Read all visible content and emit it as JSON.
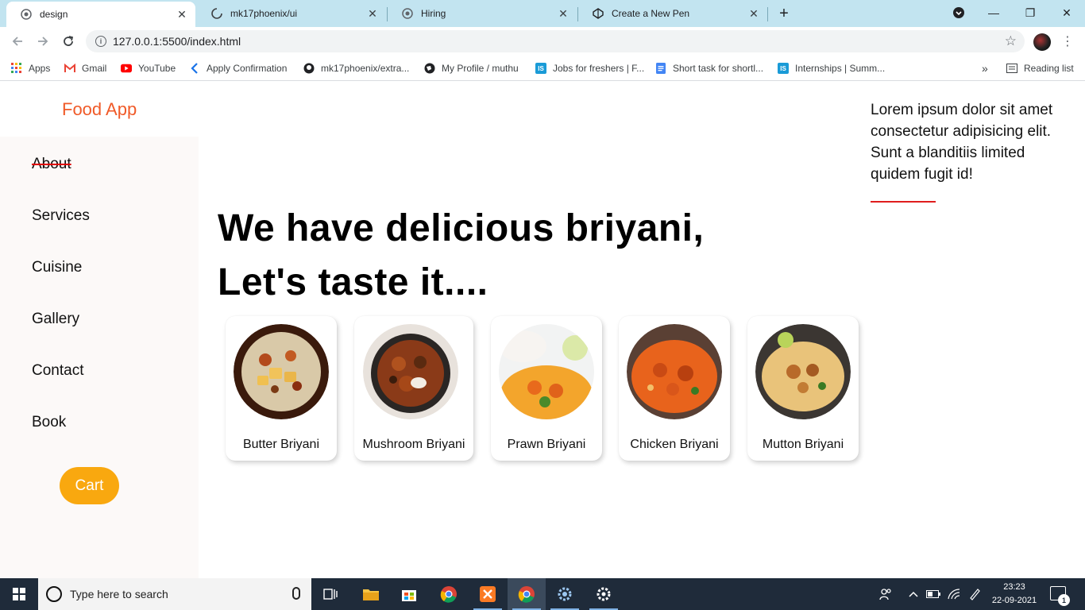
{
  "browser": {
    "tabs": [
      {
        "title": "design",
        "active": true
      },
      {
        "title": "mk17phoenix/ui",
        "active": false
      },
      {
        "title": "Hiring",
        "active": false
      },
      {
        "title": "Create a New Pen",
        "active": false
      }
    ],
    "new_tab": "+",
    "window_controls": {
      "minimize": "—",
      "restore": "❐",
      "close": "✕"
    },
    "address": "127.0.0.1:5500/index.html",
    "bookmarks": [
      {
        "label": "Apps",
        "icon": "apps-grid-icon"
      },
      {
        "label": "Gmail",
        "icon": "gmail-icon"
      },
      {
        "label": "YouTube",
        "icon": "youtube-icon"
      },
      {
        "label": "Apply Confirmation",
        "icon": "apply-icon"
      },
      {
        "label": "mk17phoenix/extra...",
        "icon": "github-icon"
      },
      {
        "label": "My Profile / muthu",
        "icon": "profile-globe-icon"
      },
      {
        "label": "Jobs for freshers | F...",
        "icon": "is-icon"
      },
      {
        "label": "Short task for shortl...",
        "icon": "docs-icon"
      },
      {
        "label": "Internships | Summ...",
        "icon": "is-icon"
      }
    ],
    "more_bookmarks": "»",
    "reading_list": "Reading list"
  },
  "app": {
    "logo": "Food App",
    "nav": [
      "About",
      "Services",
      "Cuisine",
      "Gallery",
      "Contact",
      "Book"
    ],
    "cart": "Cart",
    "headline": [
      "We have delicious briyani,",
      "Let's taste it...."
    ],
    "dishes": [
      {
        "name": "Butter Briyani"
      },
      {
        "name": "Mushroom Briyani"
      },
      {
        "name": "Prawn Briyani"
      },
      {
        "name": "Chicken Briyani"
      },
      {
        "name": "Mutton Briyani"
      }
    ],
    "aside_text": "Lorem ipsum dolor sit amet consectetur adipisicing elit. Sunt a blanditiis limited quidem fugit id!"
  },
  "taskbar": {
    "search_placeholder": "Type here to search",
    "time": "23:23",
    "date": "22-09-2021",
    "notification_count": "1"
  },
  "colors": {
    "brand": "#f05a28",
    "cart": "#f9a80f",
    "accent_rule": "#e01d1d",
    "tabstrip": "#c2e4f0",
    "taskbar": "#1f2b3a"
  }
}
